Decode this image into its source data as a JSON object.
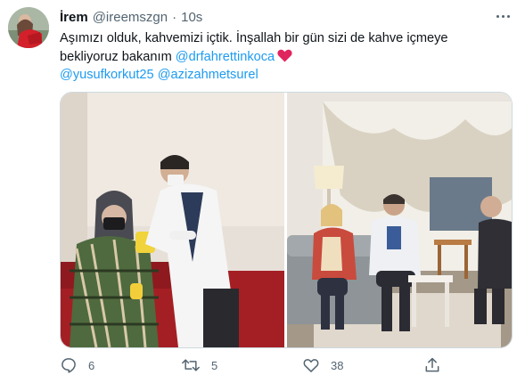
{
  "tweet": {
    "author_name": "İrem",
    "handle": "@ireemszgn",
    "separator": "·",
    "time": "10s",
    "text_line1": "Aşımızı olduk, kahvemizi içtik. İnşallah bir gün sizi de kahve içmeye",
    "text_line2_prefix": "bekliyoruz bakanım ",
    "mention_1": "@drfahrettinkoca",
    "mention_2": "@yusufkorkut25",
    "mention_3": "@azizahmetsurel",
    "emoji": "heart"
  },
  "actions": {
    "reply_count": "6",
    "retweet_count": "5",
    "like_count": "38"
  },
  "colors": {
    "link": "#1d9bf0",
    "text": "#0f1419",
    "secondary": "#536471",
    "heart": "#e0245e"
  }
}
